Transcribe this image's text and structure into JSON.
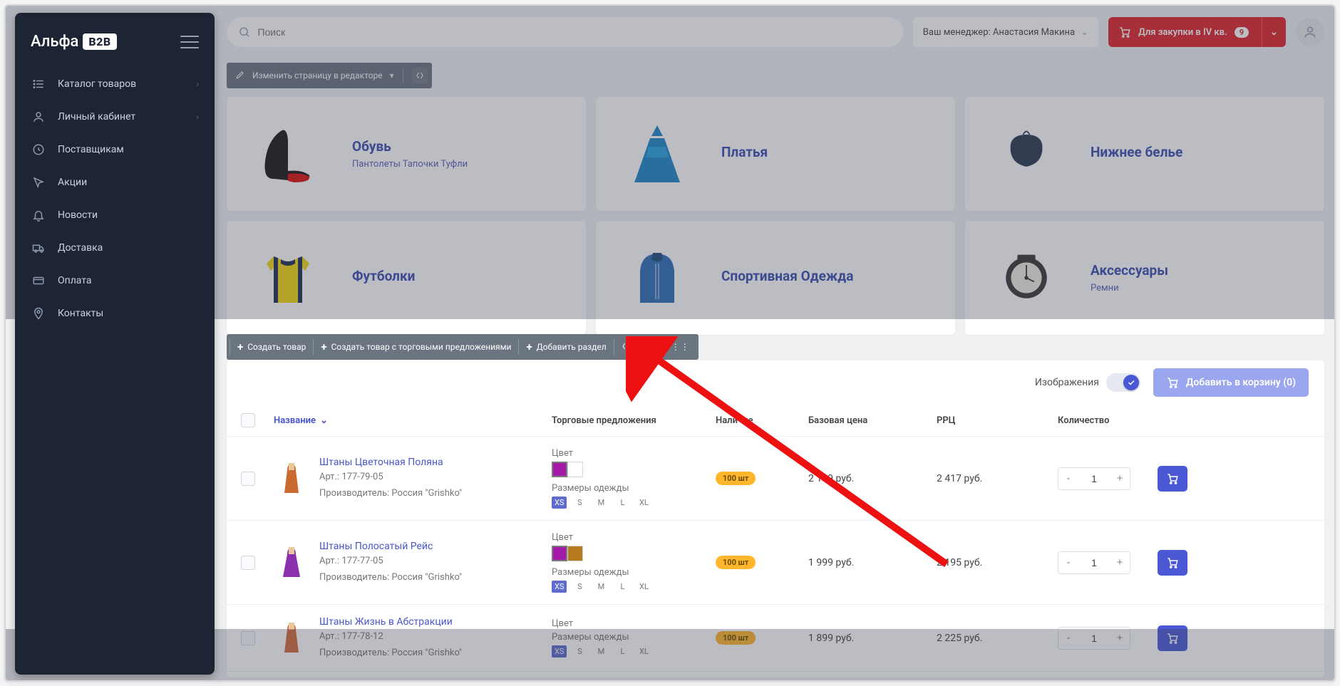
{
  "logo": {
    "text": "Альфа",
    "badge": "B2B"
  },
  "sidebar": {
    "items": [
      {
        "label": "Каталог товаров",
        "expandable": true
      },
      {
        "label": "Личный кабинет",
        "expandable": true
      },
      {
        "label": "Поставщикам"
      },
      {
        "label": "Акции"
      },
      {
        "label": "Новости"
      },
      {
        "label": "Доставка"
      },
      {
        "label": "Оплата"
      },
      {
        "label": "Контакты"
      }
    ]
  },
  "header": {
    "search_placeholder": "Поиск",
    "manager_label": "Ваш менеджер: Анастасия Макина",
    "cart_label": "Для закупки в IV кв.",
    "cart_count": "9"
  },
  "edit_bar": {
    "label": "Изменить страницу в редакторе"
  },
  "categories": [
    {
      "title": "Обувь",
      "sub": "Пантолеты   Тапочки   Туфли"
    },
    {
      "title": "Платья",
      "sub": ""
    },
    {
      "title": "Нижнее белье",
      "sub": ""
    },
    {
      "title": "Футболки",
      "sub": ""
    },
    {
      "title": "Спортивная Одежда",
      "sub": ""
    },
    {
      "title": "Аксессуары",
      "sub": "Ремни"
    }
  ],
  "prod_toolbar": {
    "create": "Создать товар",
    "create_offer": "Создать товар с торговыми предложениями",
    "add_section": "Добавить раздел"
  },
  "list": {
    "images_label": "Изображения",
    "add_cart_label": "Добавить в корзину (0)",
    "columns": {
      "name": "Название",
      "offers": "Торговые предложения",
      "stock": "Наличие",
      "base_price": "Базовая цена",
      "rrc": "РРЦ",
      "qty": "Количество"
    },
    "offer_labels": {
      "color": "Цвет",
      "sizes": "Размеры одежды"
    },
    "size_opts": [
      "XS",
      "S",
      "M",
      "L",
      "XL"
    ],
    "rows": [
      {
        "name": "Штаны Цветочная Поляна",
        "art": "Арт.: 177-79-05",
        "maker": "Производитель: Россия \"Grishko\"",
        "colors": [
          "#a31aa8",
          "#ffffff"
        ],
        "stock": "100 шт",
        "price": "2 199 руб.",
        "rrc": "2 417 руб.",
        "qty": "1"
      },
      {
        "name": "Штаны Полосатый Рейс",
        "art": "Арт.: 177-77-05",
        "maker": "Производитель: Россия \"Grishko\"",
        "colors": [
          "#a31aa8",
          "#b77b1e"
        ],
        "stock": "100 шт",
        "price": "1 999 руб.",
        "rrc": "2 195 руб.",
        "qty": "1"
      },
      {
        "name": "Штаны Жизнь в Абстракции",
        "art": "Арт.: 177-78-12",
        "maker": "Производитель: Россия \"Grishko\"",
        "colors": [],
        "stock": "100 шт",
        "price": "1 899 руб.",
        "rrc": "2 225 руб.",
        "qty": "1"
      }
    ]
  }
}
